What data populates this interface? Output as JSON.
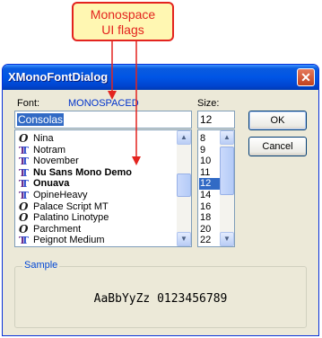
{
  "callout": {
    "line1": "Monospace",
    "line2": "UI flags"
  },
  "window": {
    "title": "XMonoFontDialog",
    "close_glyph": "✕"
  },
  "font_section": {
    "label": "Font:",
    "flag": "MONOSPACED",
    "input_value": "Consolas",
    "items": [
      {
        "name": "Nina",
        "icon": "opentype-icon",
        "bold": false
      },
      {
        "name": "Notram",
        "icon": "truetype-icon",
        "bold": false
      },
      {
        "name": "November",
        "icon": "truetype-icon",
        "bold": false
      },
      {
        "name": "Nu Sans Mono Demo",
        "icon": "truetype-icon",
        "bold": true
      },
      {
        "name": "Onuava",
        "icon": "truetype-icon",
        "bold": true
      },
      {
        "name": "OpineHeavy",
        "icon": "truetype-icon",
        "bold": false
      },
      {
        "name": "Palace Script MT",
        "icon": "opentype-icon",
        "bold": false
      },
      {
        "name": "Palatino Linotype",
        "icon": "opentype-icon",
        "bold": false
      },
      {
        "name": "Parchment",
        "icon": "opentype-icon",
        "bold": false
      },
      {
        "name": "Peignot Medium",
        "icon": "truetype-icon",
        "bold": false
      }
    ]
  },
  "size_section": {
    "label": "Size:",
    "input_value": "12",
    "items": [
      "8",
      "9",
      "10",
      "11",
      "12",
      "14",
      "16",
      "18",
      "20",
      "22"
    ],
    "selected": "12"
  },
  "buttons": {
    "ok": "OK",
    "cancel": "Cancel"
  },
  "sample": {
    "label": "Sample",
    "text": "AaBbYyZz 0123456789"
  },
  "colors": {
    "callout_border": "#e3241f",
    "callout_fill": "#fff7b2",
    "flag_text": "#0033cc",
    "selection": "#316ac5"
  }
}
